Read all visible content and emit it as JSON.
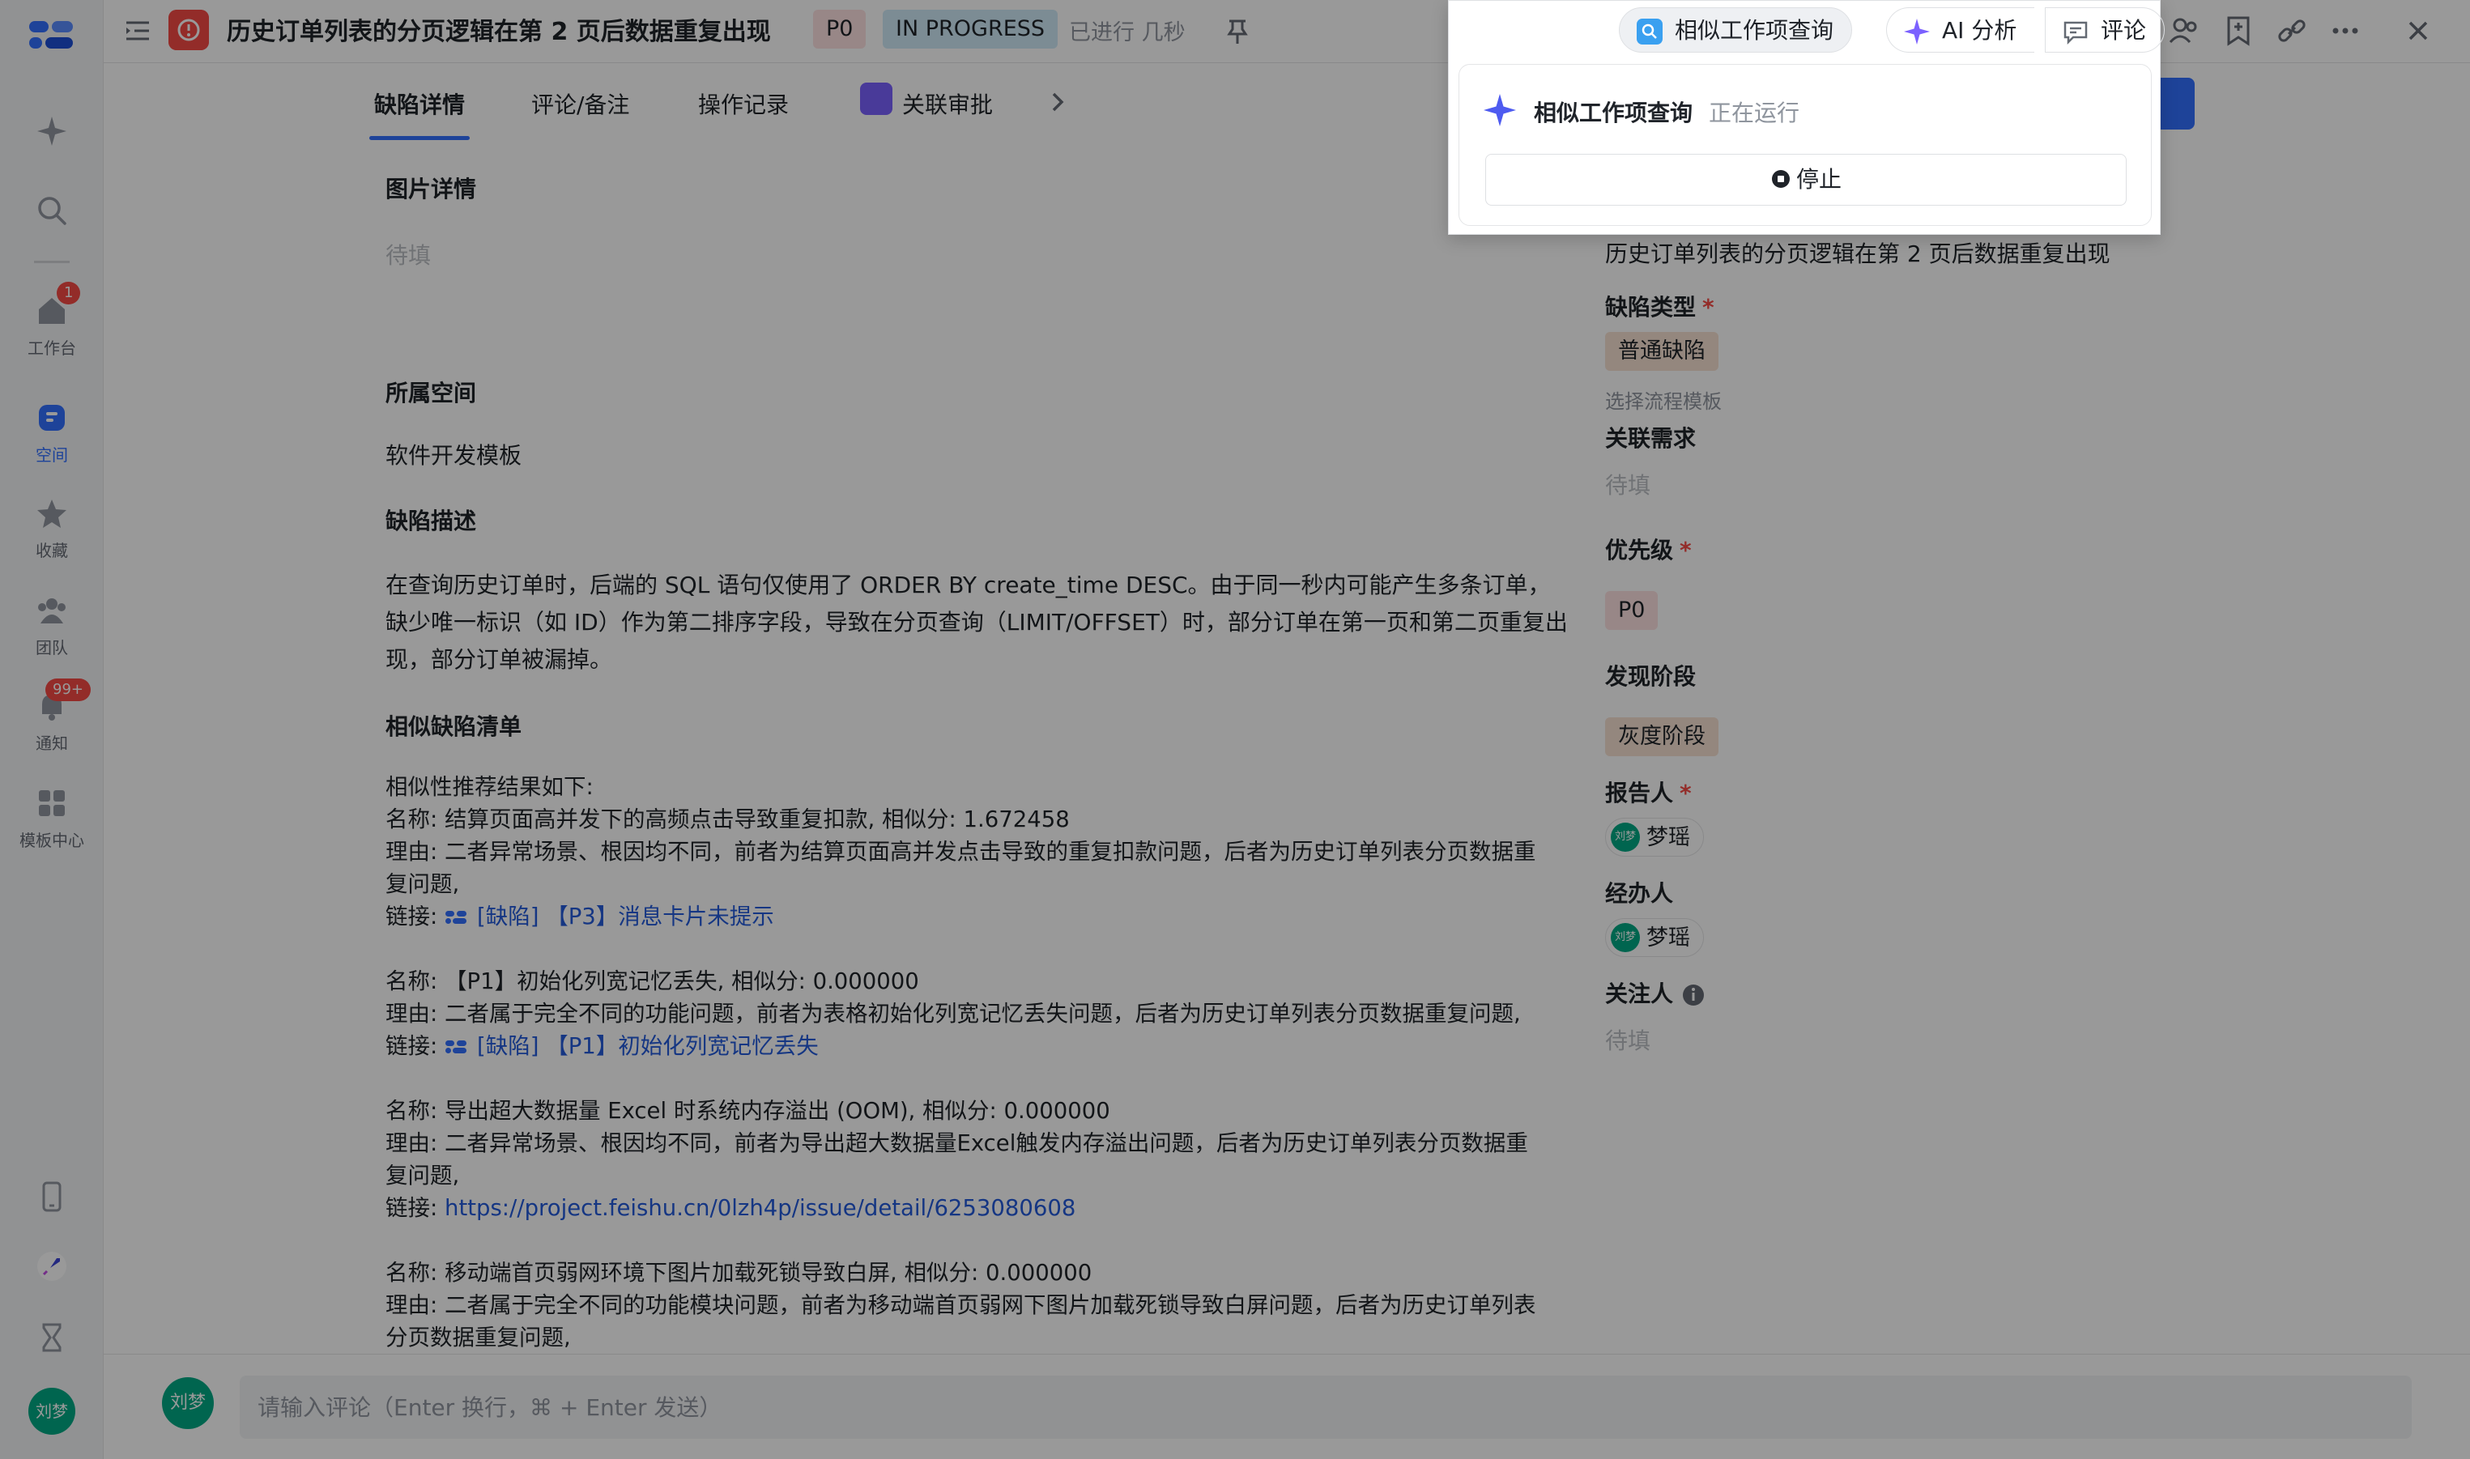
{
  "nav": {
    "items": [
      {
        "label": "工作台",
        "badge": "1"
      },
      {
        "label": "空间"
      },
      {
        "label": "收藏"
      },
      {
        "label": "团队"
      },
      {
        "label": "通知",
        "badge": "99+"
      },
      {
        "label": "模板中心"
      }
    ],
    "user_avatar": "刘梦"
  },
  "header": {
    "title": "历史订单列表的分页逻辑在第 2 页后数据重复出现",
    "priority": "P0",
    "status": "IN PROGRESS",
    "elapsed": "已进行 几秒"
  },
  "tabs": [
    "缺陷详情",
    "评论/备注",
    "操作记录",
    "关联审批"
  ],
  "main": {
    "image_title": "图片详情",
    "image_placeholder": "待填",
    "space_title": "所属空间",
    "space_value": "软件开发模板",
    "desc_title": "缺陷描述",
    "desc_text": "在查询历史订单时，后端的 SQL 语句仅使用了 ORDER BY create_time DESC。由于同一秒内可能产生多条订单，缺少唯一标识（如 ID）作为第二排序字段，导致在分页查询（LIMIT/OFFSET）时，部分订单在第一页和第二页重复出现，部分订单被漏掉。",
    "similar_title": "相似缺陷清单",
    "similar_intro": "相似性推荐结果如下:",
    "items": [
      {
        "name": "名称: 结算页面高并发下的高频点击导致重复扣款, 相似分: 1.672458",
        "reason1": "理由: 二者异常场景、根因均不同，前者为结算页面高并发点击导致的重复扣款问题，后者为历史订单列表分页数据重",
        "reason2": "复问题,",
        "link_prefix": "链接: ",
        "link": "[缺陷] 【P3】消息卡片未提示"
      },
      {
        "name": "名称: 【P1】初始化列宽记忆丢失, 相似分: 0.000000",
        "reason1": "理由: 二者属于完全不同的功能问题，前者为表格初始化列宽记忆丢失问题，后者为历史订单列表分页数据重复问题,",
        "link_prefix": "链接: ",
        "link": "[缺陷] 【P1】初始化列宽记忆丢失"
      },
      {
        "name": "名称: 导出超大数据量 Excel 时系统内存溢出 (OOM), 相似分: 0.000000",
        "reason1": "理由: 二者异常场景、根因均不同，前者为导出超大数据量Excel触发内存溢出问题，后者为历史订单列表分页数据重",
        "reason2": "复问题,",
        "link_prefix": "链接: ",
        "link": "https://project.feishu.cn/0lzh4p/issue/detail/6253080608"
      },
      {
        "name": "名称: 移动端首页弱网环境下图片加载死锁导致白屏, 相似分: 0.000000",
        "reason1": "理由: 二者属于完全不同的功能模块问题，前者为移动端首页弱网下图片加载死锁导致白屏问题，后者为历史订单列表",
        "reason2": "分页数据重复问题,"
      }
    ]
  },
  "panel": {
    "title_value": "历史订单列表的分页逻辑在第 2 页后数据重复出现",
    "bug_type_label": "缺陷类型",
    "bug_type_value": "普通缺陷",
    "flow_template": "选择流程模板",
    "related_req_label": "关联需求",
    "related_req_value": "待填",
    "priority_label": "优先级",
    "priority_value": "P0",
    "stage_label": "发现阶段",
    "stage_value": "灰度阶段",
    "reporter_label": "报告人",
    "reporter_name": "梦瑶",
    "handler_label": "经办人",
    "handler_name": "梦瑶",
    "watcher_label": "关注人",
    "watcher_value": "待填",
    "avatar_text": "刘梦"
  },
  "popup": {
    "similar_btn": "相似工作项查询",
    "ai_btn": "AI 分析",
    "comment_btn": "评论",
    "task_name": "相似工作项查询",
    "task_state": "正在运行",
    "stop_label": "停止"
  },
  "comment": {
    "avatar": "刘梦",
    "placeholder": "请输入评论（Enter 换行，⌘ + Enter 发送）"
  },
  "colors": {
    "accent": "#3370ff",
    "danger": "#f54a45",
    "link": "#245bdb",
    "avatar": "#00a884"
  }
}
